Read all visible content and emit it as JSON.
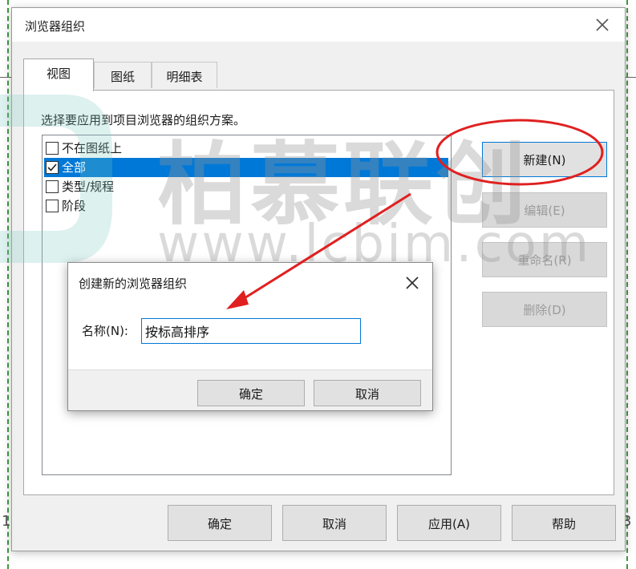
{
  "window": {
    "title": "浏览器组织",
    "tabs": [
      {
        "label": "视图",
        "active": true
      },
      {
        "label": "图纸",
        "active": false
      },
      {
        "label": "明细表",
        "active": false
      }
    ],
    "instruction": "选择要应用到项目浏览器的组织方案。",
    "list_items": [
      {
        "label": "不在图纸上",
        "checked": false,
        "selected": false
      },
      {
        "label": "全部",
        "checked": true,
        "selected": true
      },
      {
        "label": "类型/规程",
        "checked": false,
        "selected": false
      },
      {
        "label": "阶段",
        "checked": false,
        "selected": false
      }
    ],
    "side_buttons": {
      "new": "新建(N)",
      "edit": "编辑(E)",
      "rename": "重命名(R)",
      "delete": "删除(D)"
    },
    "bottom_buttons": {
      "ok": "确定",
      "cancel": "取消",
      "apply": "应用(A)",
      "help": "帮助"
    }
  },
  "new_dialog": {
    "title": "创建新的浏览器组织",
    "name_label": "名称(N):",
    "name_value": "按标高排序",
    "ok": "确定",
    "cancel": "取消"
  },
  "watermark": {
    "text": "柏慕联创",
    "url": "www.lcbim.com"
  },
  "background_edge": {
    "left_glyph": "1",
    "right_glyph": "3"
  },
  "colors": {
    "selection": "#0078d7",
    "annotation": "#e02020"
  },
  "icons": [
    "close-icon",
    "checkmark-icon",
    "arrow-annotation",
    "highlight-ellipse"
  ]
}
